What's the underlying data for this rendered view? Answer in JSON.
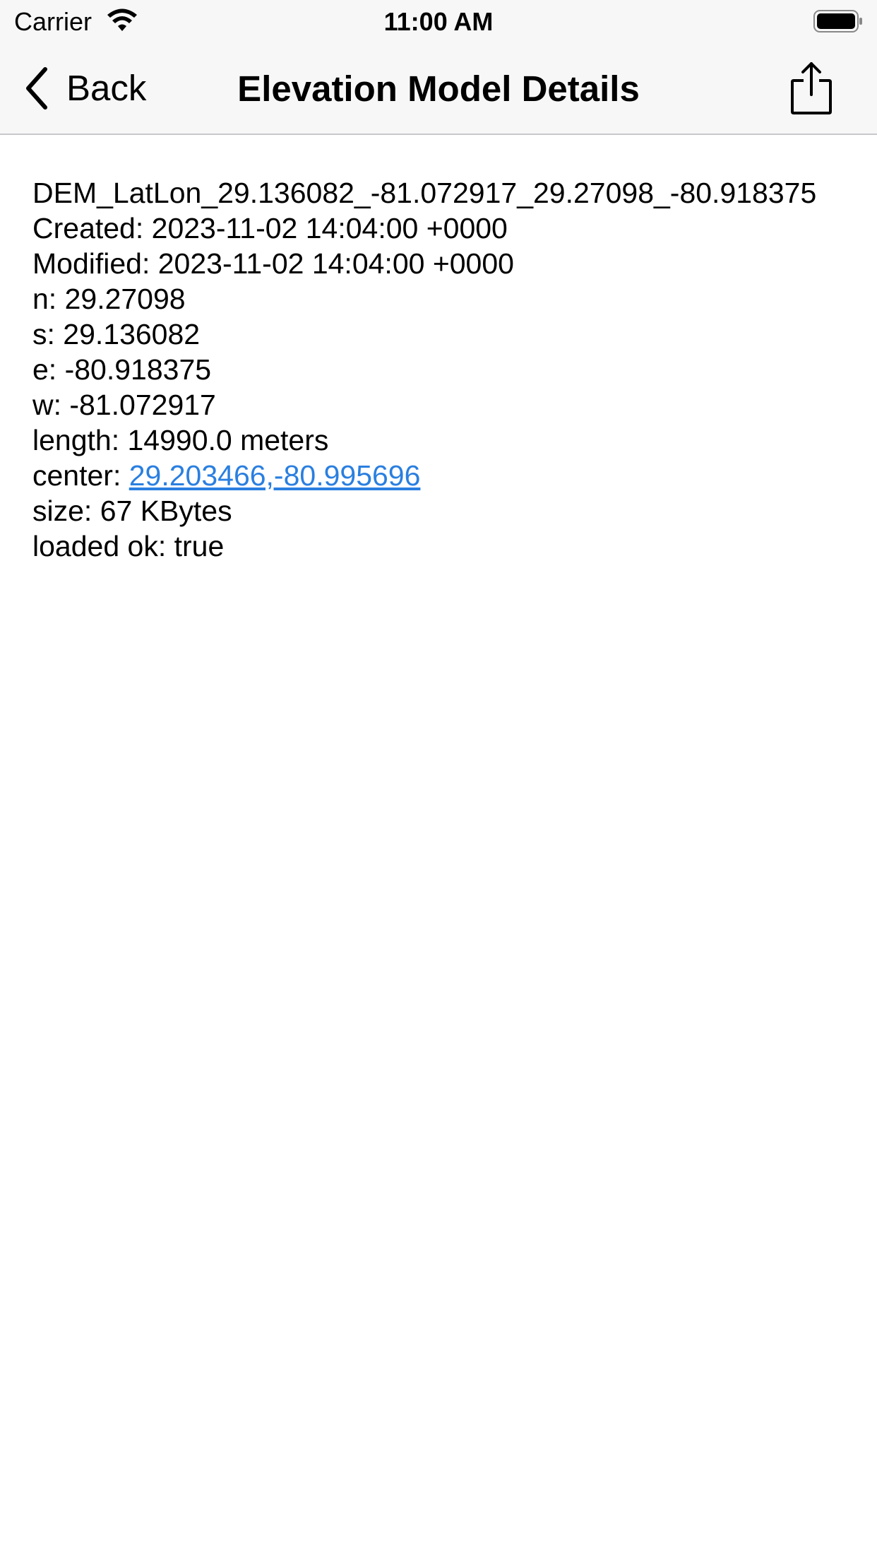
{
  "status_bar": {
    "carrier": "Carrier",
    "time": "11:00 AM",
    "wifi_icon": "wifi-icon",
    "battery_icon": "battery-full-icon"
  },
  "nav": {
    "back_label": "Back",
    "back_icon": "chevron-left-icon",
    "title": "Elevation Model Details",
    "share_icon": "share-icon"
  },
  "details": {
    "filename": "DEM_LatLon_29.136082_-81.072917_29.27098_-80.918375",
    "created": "Created: 2023-11-02 14:04:00 +0000",
    "modified": "Modified: 2023-11-02 14:04:00 +0000",
    "north": "n: 29.27098",
    "south": "s: 29.136082",
    "east": "e: -80.918375",
    "west": "w: -81.072917",
    "length": "length: 14990.0 meters",
    "center_label": "center: ",
    "center_link": "29.203466,-80.995696",
    "size": "size: 67 KBytes",
    "loaded": "loaded ok: true"
  },
  "colors": {
    "link": "#2a7fe0",
    "bar_background": "#f7f7f7",
    "separator": "#c8c8cc"
  }
}
